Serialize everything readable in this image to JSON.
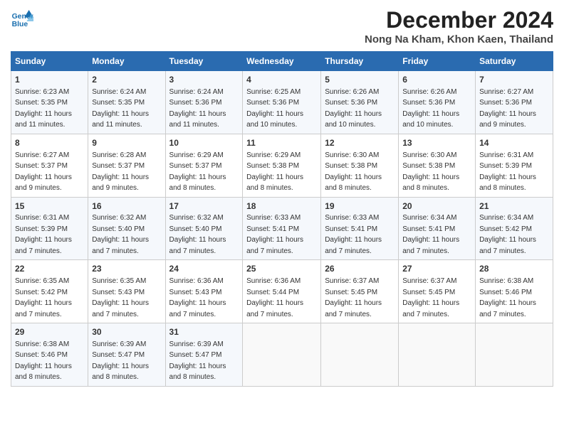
{
  "logo": {
    "line1": "General",
    "line2": "Blue"
  },
  "title": "December 2024",
  "subtitle": "Nong Na Kham, Khon Kaen, Thailand",
  "days_of_week": [
    "Sunday",
    "Monday",
    "Tuesday",
    "Wednesday",
    "Thursday",
    "Friday",
    "Saturday"
  ],
  "weeks": [
    [
      {
        "day": "1",
        "sunrise": "6:23 AM",
        "sunset": "5:35 PM",
        "daylight": "11 hours and 11 minutes."
      },
      {
        "day": "2",
        "sunrise": "6:24 AM",
        "sunset": "5:35 PM",
        "daylight": "11 hours and 11 minutes."
      },
      {
        "day": "3",
        "sunrise": "6:24 AM",
        "sunset": "5:36 PM",
        "daylight": "11 hours and 11 minutes."
      },
      {
        "day": "4",
        "sunrise": "6:25 AM",
        "sunset": "5:36 PM",
        "daylight": "11 hours and 10 minutes."
      },
      {
        "day": "5",
        "sunrise": "6:26 AM",
        "sunset": "5:36 PM",
        "daylight": "11 hours and 10 minutes."
      },
      {
        "day": "6",
        "sunrise": "6:26 AM",
        "sunset": "5:36 PM",
        "daylight": "11 hours and 10 minutes."
      },
      {
        "day": "7",
        "sunrise": "6:27 AM",
        "sunset": "5:36 PM",
        "daylight": "11 hours and 9 minutes."
      }
    ],
    [
      {
        "day": "8",
        "sunrise": "6:27 AM",
        "sunset": "5:37 PM",
        "daylight": "11 hours and 9 minutes."
      },
      {
        "day": "9",
        "sunrise": "6:28 AM",
        "sunset": "5:37 PM",
        "daylight": "11 hours and 9 minutes."
      },
      {
        "day": "10",
        "sunrise": "6:29 AM",
        "sunset": "5:37 PM",
        "daylight": "11 hours and 8 minutes."
      },
      {
        "day": "11",
        "sunrise": "6:29 AM",
        "sunset": "5:38 PM",
        "daylight": "11 hours and 8 minutes."
      },
      {
        "day": "12",
        "sunrise": "6:30 AM",
        "sunset": "5:38 PM",
        "daylight": "11 hours and 8 minutes."
      },
      {
        "day": "13",
        "sunrise": "6:30 AM",
        "sunset": "5:38 PM",
        "daylight": "11 hours and 8 minutes."
      },
      {
        "day": "14",
        "sunrise": "6:31 AM",
        "sunset": "5:39 PM",
        "daylight": "11 hours and 8 minutes."
      }
    ],
    [
      {
        "day": "15",
        "sunrise": "6:31 AM",
        "sunset": "5:39 PM",
        "daylight": "11 hours and 7 minutes."
      },
      {
        "day": "16",
        "sunrise": "6:32 AM",
        "sunset": "5:40 PM",
        "daylight": "11 hours and 7 minutes."
      },
      {
        "day": "17",
        "sunrise": "6:32 AM",
        "sunset": "5:40 PM",
        "daylight": "11 hours and 7 minutes."
      },
      {
        "day": "18",
        "sunrise": "6:33 AM",
        "sunset": "5:41 PM",
        "daylight": "11 hours and 7 minutes."
      },
      {
        "day": "19",
        "sunrise": "6:33 AM",
        "sunset": "5:41 PM",
        "daylight": "11 hours and 7 minutes."
      },
      {
        "day": "20",
        "sunrise": "6:34 AM",
        "sunset": "5:41 PM",
        "daylight": "11 hours and 7 minutes."
      },
      {
        "day": "21",
        "sunrise": "6:34 AM",
        "sunset": "5:42 PM",
        "daylight": "11 hours and 7 minutes."
      }
    ],
    [
      {
        "day": "22",
        "sunrise": "6:35 AM",
        "sunset": "5:42 PM",
        "daylight": "11 hours and 7 minutes."
      },
      {
        "day": "23",
        "sunrise": "6:35 AM",
        "sunset": "5:43 PM",
        "daylight": "11 hours and 7 minutes."
      },
      {
        "day": "24",
        "sunrise": "6:36 AM",
        "sunset": "5:43 PM",
        "daylight": "11 hours and 7 minutes."
      },
      {
        "day": "25",
        "sunrise": "6:36 AM",
        "sunset": "5:44 PM",
        "daylight": "11 hours and 7 minutes."
      },
      {
        "day": "26",
        "sunrise": "6:37 AM",
        "sunset": "5:45 PM",
        "daylight": "11 hours and 7 minutes."
      },
      {
        "day": "27",
        "sunrise": "6:37 AM",
        "sunset": "5:45 PM",
        "daylight": "11 hours and 7 minutes."
      },
      {
        "day": "28",
        "sunrise": "6:38 AM",
        "sunset": "5:46 PM",
        "daylight": "11 hours and 7 minutes."
      }
    ],
    [
      {
        "day": "29",
        "sunrise": "6:38 AM",
        "sunset": "5:46 PM",
        "daylight": "11 hours and 8 minutes."
      },
      {
        "day": "30",
        "sunrise": "6:39 AM",
        "sunset": "5:47 PM",
        "daylight": "11 hours and 8 minutes."
      },
      {
        "day": "31",
        "sunrise": "6:39 AM",
        "sunset": "5:47 PM",
        "daylight": "11 hours and 8 minutes."
      },
      null,
      null,
      null,
      null
    ]
  ],
  "labels": {
    "sunrise": "Sunrise:",
    "sunset": "Sunset:",
    "daylight": "Daylight:"
  }
}
